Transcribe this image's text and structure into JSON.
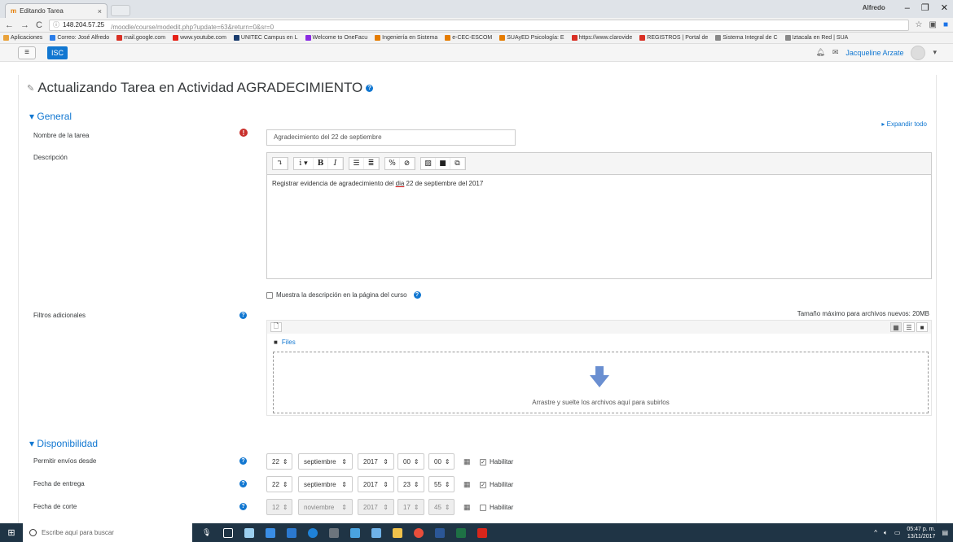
{
  "browser": {
    "tab_title": "Editando Tarea",
    "tab_close": "×",
    "window_user": "Alfredo",
    "url_host": "148.204.57.25",
    "url_path": "/moodle/course/modedit.php?update=63&return=0&sr=0",
    "bookmarks": [
      {
        "label": "Aplicaciones",
        "color": "#e9a23b"
      },
      {
        "label": "Correo: José Alfredo",
        "color": "#2b7de9"
      },
      {
        "label": "mail.google.com",
        "color": "#d93025"
      },
      {
        "label": "www.youtube.com",
        "color": "#e62117"
      },
      {
        "label": "UNITEC Campus en L",
        "color": "#1a3c6e"
      },
      {
        "label": "Welcome to OneFacu",
        "color": "#8a2be2"
      },
      {
        "label": "Ingeniería en Sistema",
        "color": "#e57c00"
      },
      {
        "label": "e-CEC-ESCOM",
        "color": "#e57c00"
      },
      {
        "label": "SUAyED Psicología: E",
        "color": "#e57c00"
      },
      {
        "label": "https://www.clarovide",
        "color": "#d93025"
      },
      {
        "label": "REGISTROS | Portal de",
        "color": "#d93025"
      },
      {
        "label": "Sistema Integral de C",
        "color": "#888888"
      },
      {
        "label": "Iztacala en Red | SUA",
        "color": "#888888"
      }
    ]
  },
  "navbar": {
    "menu_icon": "≡",
    "brand": "ISC",
    "user": "Jacqueline Arzate",
    "caret": "▾"
  },
  "page": {
    "title": "Actualizando Tarea en Actividad AGRADECIMIENTO",
    "expand_all": "Expandir todo",
    "general": {
      "heading": "General",
      "name_label": "Nombre de la tarea",
      "name_value": "Agradecimiento del 22 de septiembre",
      "desc_label": "Descripción",
      "desc_text_before": "Registrar evidencia de agradecimiento del ",
      "desc_text_underlined": "dia",
      "desc_text_after": " 22 de septiembre del 2017",
      "show_desc_label": "Muestra la descripción en la página del curso",
      "files_label": "Filtros adicionales",
      "max_size": "Tamaño máximo para archivos nuevos: 20MB",
      "files_path": "Files",
      "drop_text": "Arrastre y suelte los archivos aquí para subirlos"
    },
    "disponibilidad": {
      "heading": "Disponibilidad",
      "rows": [
        {
          "label": "Permitir envíos desde",
          "day": "22",
          "month": "septiembre",
          "year": "2017",
          "hour": "00",
          "minute": "00",
          "enable_label": "Habilitar",
          "enabled": true
        },
        {
          "label": "Fecha de entrega",
          "day": "22",
          "month": "septiembre",
          "year": "2017",
          "hour": "23",
          "minute": "55",
          "enable_label": "Habilitar",
          "enabled": true
        },
        {
          "label": "Fecha de corte",
          "day": "12",
          "month": "noviembre",
          "year": "2017",
          "hour": "17",
          "minute": "45",
          "enable_label": "Habilitar",
          "enabled": false
        }
      ]
    }
  },
  "taskbar": {
    "search_placeholder": "Escribe aquí para buscar",
    "time": "05:47 p. m.",
    "date": "13/11/2017"
  }
}
